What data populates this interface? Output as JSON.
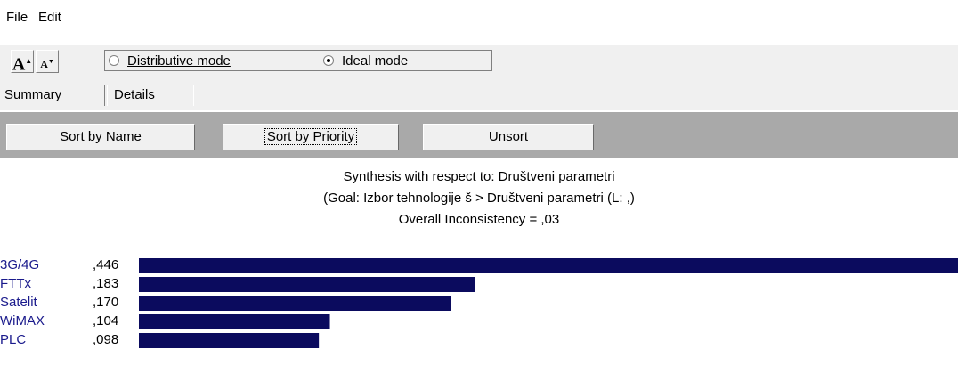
{
  "menu": {
    "file": "File",
    "edit": "Edit"
  },
  "toolbar": {
    "font_increase_label": "A",
    "font_decrease_label": "A",
    "modes": [
      {
        "label": "Distributive mode",
        "selected": false
      },
      {
        "label": "Ideal mode",
        "selected": true
      }
    ]
  },
  "tabs": [
    {
      "label": "Summary",
      "active": true
    },
    {
      "label": "Details",
      "active": false
    }
  ],
  "sort_buttons": [
    {
      "label": "Sort by Name"
    },
    {
      "label": "Sort by Priority",
      "focused": true
    },
    {
      "label": "Unsort"
    }
  ],
  "colors": {
    "bar": "#0b0b5e",
    "label": "#1a1a8c",
    "sortbar_bg": "#a9a9a9"
  },
  "chart_data": {
    "type": "bar",
    "orientation": "horizontal",
    "title_lines": [
      "Synthesis with respect to: Društveni parametri",
      "(Goal: Izbor tehnologije š > Društveni parametri (L: ,)",
      "Overall Inconsistency = ,03"
    ],
    "categories": [
      "3G/4G",
      "FTTx",
      "Satelit",
      "WiMAX",
      "PLC"
    ],
    "values": [
      0.446,
      0.183,
      0.17,
      0.104,
      0.098
    ],
    "value_labels": [
      ",446",
      ",183",
      ",170",
      ",104",
      ",098"
    ],
    "xlim": [
      0,
      0.446
    ],
    "grid": false,
    "legend": "none"
  }
}
